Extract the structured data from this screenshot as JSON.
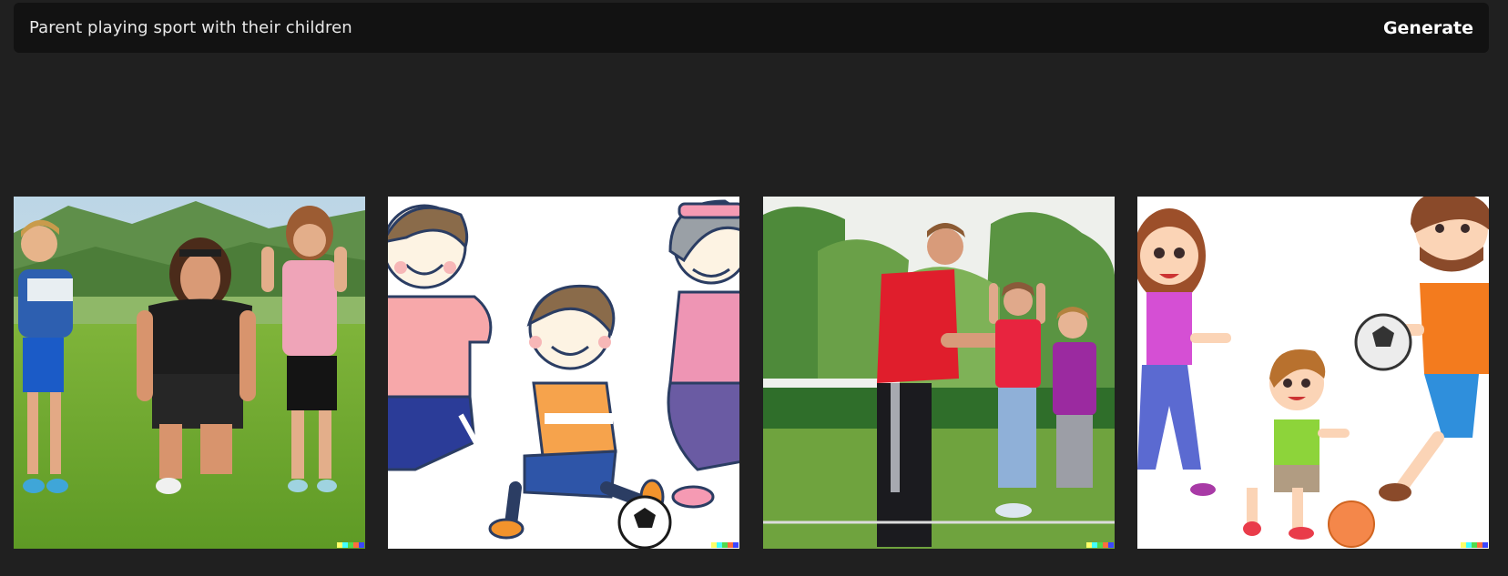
{
  "prompt": {
    "text": "Parent playing sport with their children",
    "generate_label": "Generate"
  },
  "results": [
    {
      "style": "photo",
      "subject": "mother-and-two-children-crouching-on-grass"
    },
    {
      "style": "illustration",
      "subject": "cartoon-children-kicking-soccer-ball"
    },
    {
      "style": "photo",
      "subject": "father-with-two-girls-in-park"
    },
    {
      "style": "illustration",
      "subject": "cartoon-family-playing-soccer"
    }
  ],
  "colors": {
    "page_bg": "#202020",
    "bar_bg": "#121212",
    "signature": [
      "#ffff66",
      "#42ffff",
      "#51da4c",
      "#ff6e3c",
      "#3c46ff"
    ]
  }
}
